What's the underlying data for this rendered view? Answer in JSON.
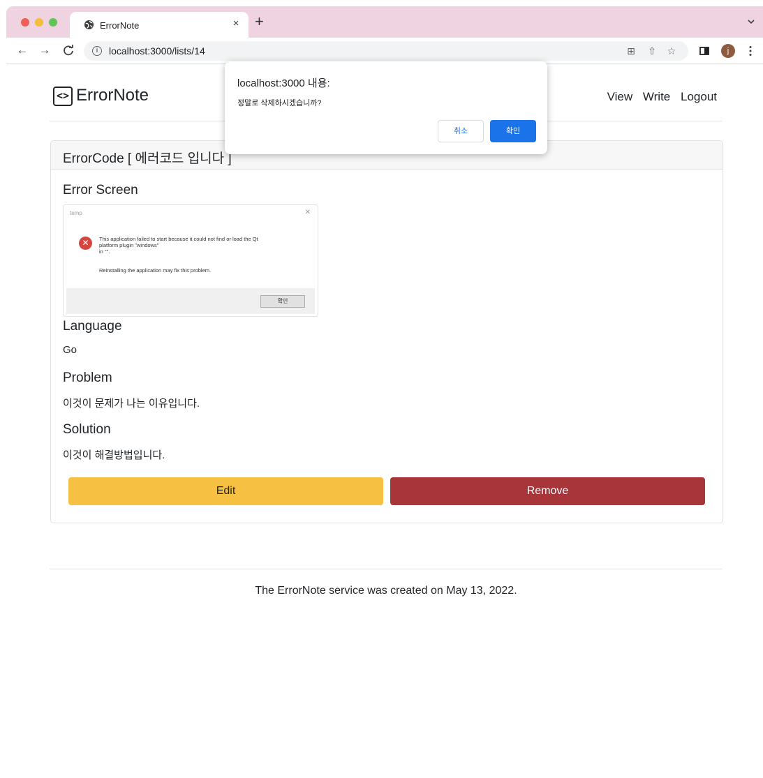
{
  "browser": {
    "tab_title": "ErrorNote",
    "tab_close": "×",
    "new_tab": "+",
    "url": "localhost:3000/lists/14",
    "avatar_letter": "j",
    "icons": [
      "globe-icon",
      "back-icon",
      "forward-icon",
      "reload-icon",
      "info-icon",
      "translate-icon",
      "share-icon",
      "star-icon",
      "sidebar-icon",
      "menu-icon",
      "chevron-down-icon"
    ]
  },
  "site": {
    "brand_icon": "<>",
    "brand": "ErrorNote",
    "nav": [
      "View",
      "Write",
      "Logout"
    ]
  },
  "card": {
    "title": "ErrorCode [ 에러코드 입니다 ]",
    "error_screen_heading": "Error Screen",
    "screenshot": {
      "window_title": "temp",
      "message_line1": "This application failed to start because it could not find or load the Qt",
      "message_line2": "platform plugin \"windows\"",
      "message_line3": "in \"\".",
      "message_line4": "Reinstalling the application may fix this problem.",
      "button": "확인"
    },
    "language_heading": "Language",
    "language": "Go",
    "problem_heading": "Problem",
    "problem": "이것이 문제가 나는 이유입니다.",
    "solution_heading": "Solution",
    "solution": "이것이 해결방법입니다.",
    "edit_label": "Edit",
    "remove_label": "Remove"
  },
  "footer": {
    "text": "The ErrorNote service was created on May 13, 2022."
  },
  "dialog": {
    "title": "localhost:3000 내용:",
    "message": "정말로 삭제하시겠습니까?",
    "cancel_label": "취소",
    "ok_label": "확인"
  },
  "colors": {
    "tabbar": "#efd3e0",
    "edit_button": "#f6c142",
    "remove_button": "#a8353a",
    "dialog_ok": "#1a73e8"
  }
}
